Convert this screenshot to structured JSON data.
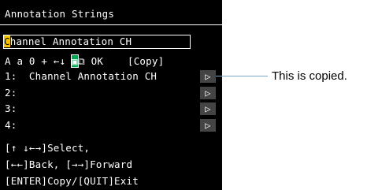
{
  "window": {
    "title": "Annotation Strings"
  },
  "input": {
    "cursor_char": "C",
    "rest": "hannel Annotation CH"
  },
  "toolbar": {
    "pre": "A a 0 + ",
    "left_arrow": "←",
    "down_arrow": "↓",
    "selected_icon": "▣",
    "copy_icon": "⧉",
    "ok_label": "OK",
    "copy_label": "[Copy]"
  },
  "slots": [
    {
      "label": "1:  Channel Annotation CH",
      "play": "▷"
    },
    {
      "label": "2:",
      "play": "▷"
    },
    {
      "label": "3:",
      "play": "▷"
    },
    {
      "label": "4:",
      "play": "▷"
    }
  ],
  "help": [
    "[↑ ↓←→]Select,",
    "[←←]Back, [→→]Forward",
    "[ENTER]Copy/[QUIT]Exit"
  ],
  "callout": {
    "text": "This is copied."
  }
}
